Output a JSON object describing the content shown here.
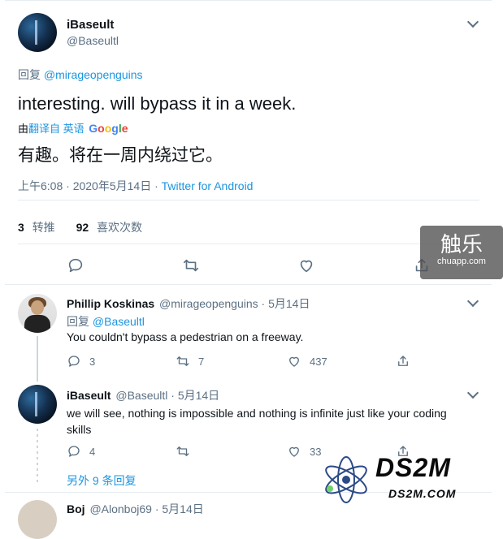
{
  "main_tweet": {
    "display_name": "iBaseult",
    "handle": "@Baseultl",
    "reply_label": "回复",
    "reply_to": "@mirageopenguins",
    "text": "interesting. will bypass it in a week.",
    "translate_by": "由",
    "translate_from": "翻译自 英语",
    "translate_engine": "Google",
    "translation": "有趣。将在一周内绕过它。",
    "timestamp": "上午6:08 · 2020年5月14日 ·",
    "source": "Twitter for Android",
    "retweet_count": "3",
    "retweet_label": "转推",
    "like_count": "92",
    "like_label": "喜欢次数"
  },
  "replies": [
    {
      "display_name": "Phillip Koskinas",
      "handle": "@mirageopenguins · 5月14日",
      "reply_label": "回复",
      "reply_to": "@Baseultl",
      "text": "You couldn't bypass a pedestrian on a freeway.",
      "reply_count": "3",
      "retweet_count": "7",
      "like_count": "437"
    },
    {
      "display_name": "iBaseult",
      "handle": "@Baseultl · 5月14日",
      "text_line1": "we will see, nothing is impossible and nothing is infinite just like your coding",
      "text_line2": "skills",
      "reply_count": "4",
      "retweet_count": "",
      "like_count": "33"
    }
  ],
  "more_replies": "另外 9 条回复",
  "partial_reply": {
    "display_name": "Boj",
    "handle": "@Alonboj69 · 5月14日"
  },
  "watermark_chuapp": {
    "title": "触乐",
    "subtitle": "chuapp.com"
  },
  "watermark_ds2m": {
    "brand": "DS2M",
    "domain": "DS2M.COM"
  },
  "colors": {
    "link": "#1b95e0",
    "muted": "#5b7083",
    "google_blue": "#4285F4",
    "google_red": "#EA4335",
    "google_yellow": "#FBBC05",
    "google_green": "#34A853"
  }
}
